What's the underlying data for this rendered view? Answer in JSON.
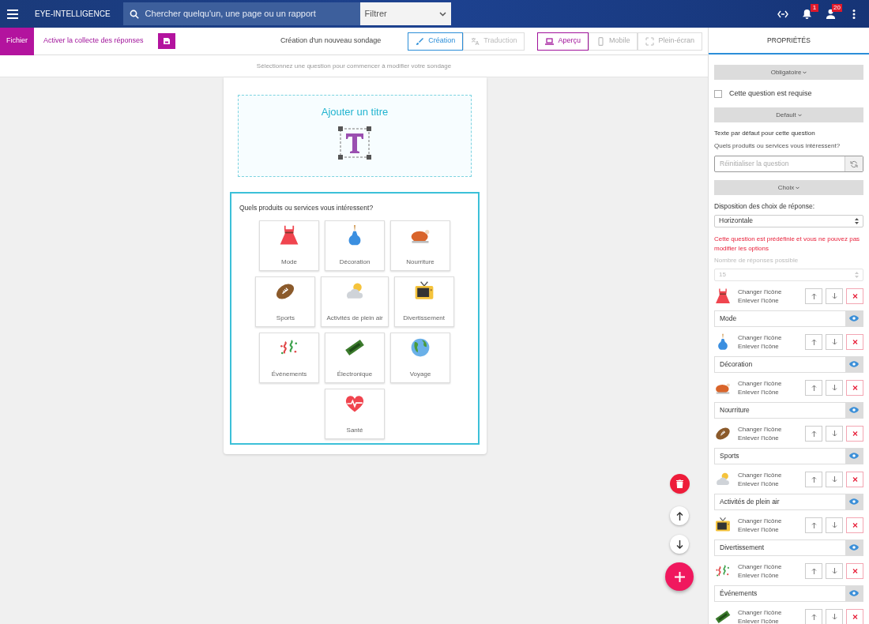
{
  "app_bar": {
    "brand": "EYE-INTELLIGENCE",
    "search_placeholder": "Chercher quelqu'un, une page ou un rapport",
    "filter": "Filtrer",
    "notification_badge": "1",
    "user_badge": "20"
  },
  "toolbar": {
    "file_button": "Fichier",
    "collect_link": "Activer la collecte des réponses",
    "title": "Création d'un nouveau sondage",
    "mode_tabs": [
      {
        "label": "Création",
        "kind": "brush",
        "selected": true,
        "disabled": false
      },
      {
        "label": "Traduction",
        "kind": "translate",
        "selected": false,
        "disabled": true
      }
    ],
    "view_tabs": [
      {
        "label": "Aperçu",
        "kind": "laptop",
        "selected": true
      },
      {
        "label": "Mobile",
        "kind": "phone",
        "selected": false
      },
      {
        "label": "Plein-écran",
        "kind": "fullscreen",
        "selected": false
      }
    ]
  },
  "hint": "Sélectionnez une question pour commencer à modifier votre sondage",
  "survey": {
    "title_placeholder": "Ajouter un titre",
    "question": "Quels produits ou services vous intéressent?",
    "choices": [
      {
        "label": "Mode",
        "kind": "dress"
      },
      {
        "label": "Décoration",
        "kind": "vase"
      },
      {
        "label": "Nourriture",
        "kind": "turkey"
      },
      {
        "label": "Sports",
        "kind": "football"
      },
      {
        "label": "Activités de plein air",
        "kind": "weather"
      },
      {
        "label": "Divertissement",
        "kind": "tv"
      },
      {
        "label": "Événements",
        "kind": "confetti"
      },
      {
        "label": "Électronique",
        "kind": "chip"
      },
      {
        "label": "Voyage",
        "kind": "globe"
      },
      {
        "label": "Santé",
        "kind": "heart"
      }
    ]
  },
  "properties": {
    "title": "PROPRIÉTÉS",
    "required_section": "Obligatoire",
    "required_label": "Cette question est requise",
    "required_checked": false,
    "default_section": "Default",
    "default_label": "Texte par défaut pour cette question",
    "default_text": "Quels produits ou services vous intéressent?",
    "reset_placeholder": "Réinitialiser la question",
    "choices_section": "Choix",
    "layout_label": "Disposition des choix de réponse:",
    "layout_value": "Horizontale",
    "warning": "Cette question est prédéfinie et vous ne pouvez pas modifier les options",
    "count_label": "Nombre de réponses possible",
    "count_value": "15",
    "choice_rows": [
      {
        "kind": "dress",
        "change": "Changer l'icône",
        "remove": "Enlever l'icône",
        "label": "Mode"
      },
      {
        "kind": "vase",
        "change": "Changer l'icône",
        "remove": "Enlever l'icône",
        "label": "Décoration"
      },
      {
        "kind": "turkey",
        "change": "Changer l'icône",
        "remove": "Enlever l'icône",
        "label": "Nourriture"
      },
      {
        "kind": "football",
        "change": "Changer l'icône",
        "remove": "Enlever l'icône",
        "label": "Sports"
      },
      {
        "kind": "weather",
        "change": "Changer l'icône",
        "remove": "Enlever l'icône",
        "label": "Activités de plein air"
      },
      {
        "kind": "tv",
        "change": "Changer l'icône",
        "remove": "Enlever l'icône",
        "label": "Divertissement"
      },
      {
        "kind": "confetti",
        "change": "Changer l'icône",
        "remove": "Enlever l'icône",
        "label": "Événements"
      },
      {
        "kind": "chip",
        "change": "Changer l'icône",
        "remove": "Enlever l'icône"
      }
    ]
  }
}
